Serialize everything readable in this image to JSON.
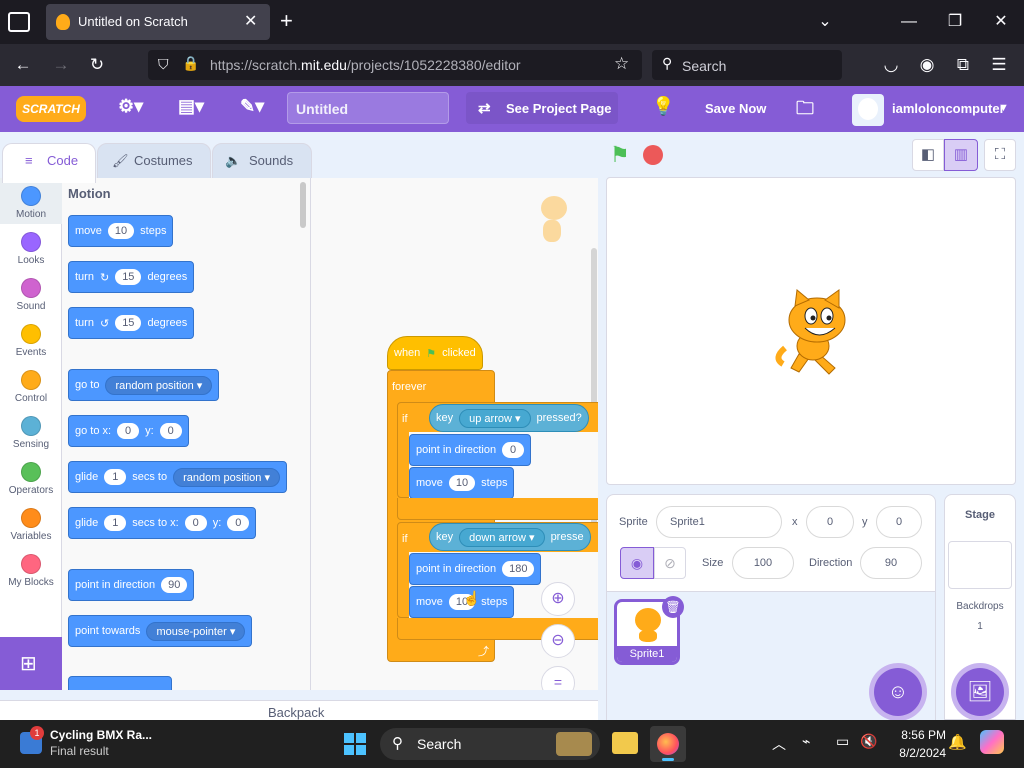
{
  "browser": {
    "tab_title": "Untitled on Scratch",
    "url_prefix": "https://scratch.",
    "url_domain": "mit.edu",
    "url_path": "/projects/1052228380/editor",
    "search_placeholder": "Search"
  },
  "menubar": {
    "logo": "SCRATCH",
    "project_title": "Untitled",
    "see_project_page": "See Project Page",
    "save_now": "Save Now",
    "username": "iamloloncomputer"
  },
  "editor_tabs": {
    "code": "Code",
    "costumes": "Costumes",
    "sounds": "Sounds"
  },
  "categories": [
    {
      "label": "Motion",
      "color": "#4c97ff"
    },
    {
      "label": "Looks",
      "color": "#9966ff"
    },
    {
      "label": "Sound",
      "color": "#cf63cf"
    },
    {
      "label": "Events",
      "color": "#ffbf00"
    },
    {
      "label": "Control",
      "color": "#ffab19"
    },
    {
      "label": "Sensing",
      "color": "#5cb1d6"
    },
    {
      "label": "Operators",
      "color": "#59c059"
    },
    {
      "label": "Variables",
      "color": "#ff8c1a"
    },
    {
      "label": "My Blocks",
      "color": "#ff6680"
    }
  ],
  "palette": {
    "heading": "Motion",
    "move": {
      "a": "move",
      "v": "10",
      "b": "steps"
    },
    "turn_right": {
      "a": "turn",
      "v": "15",
      "b": "degrees"
    },
    "turn_left": {
      "a": "turn",
      "v": "15",
      "b": "degrees"
    },
    "goto": {
      "a": "go to",
      "v": "random position"
    },
    "goto_xy": {
      "a": "go to x:",
      "x": "0",
      "b": "y:",
      "y": "0"
    },
    "glide_to": {
      "a": "glide",
      "v": "1",
      "b": "secs to",
      "c": "random position"
    },
    "glide_xy": {
      "a": "glide",
      "v": "1",
      "b": "secs to x:",
      "x": "0",
      "c": "y:",
      "y": "0"
    },
    "point_dir": {
      "a": "point in direction",
      "v": "90"
    },
    "point_towards": {
      "a": "point towards",
      "v": "mouse-pointer"
    }
  },
  "script": {
    "hat": {
      "a": "when",
      "b": "clicked"
    },
    "forever": "forever",
    "if1": {
      "if": "if",
      "key": "key",
      "keyname": "up arrow",
      "pressed": "pressed?"
    },
    "point1": {
      "a": "point in direction",
      "v": "0"
    },
    "move1": {
      "a": "move",
      "v": "10",
      "b": "steps"
    },
    "if2": {
      "if": "if",
      "key": "key",
      "keyname": "down arrow",
      "pressed": "presse"
    },
    "point2": {
      "a": "point in direction",
      "v": "180"
    },
    "move2": {
      "a": "move",
      "v": "10",
      "b": "steps"
    }
  },
  "backpack": "Backpack",
  "sprite_info": {
    "sprite_label": "Sprite",
    "sprite_name": "Sprite1",
    "x_label": "x",
    "x": "0",
    "y_label": "y",
    "y": "0",
    "size_label": "Size",
    "size": "100",
    "direction_label": "Direction",
    "direction": "90"
  },
  "sprite_thumb": "Sprite1",
  "stage_panel": {
    "title": "Stage",
    "backdrops_label": "Backdrops",
    "backdrops_count": "1"
  },
  "taskbar": {
    "notif_badge": "1",
    "notif_title": "Cycling BMX Ra...",
    "notif_sub": "Final result",
    "search": "Search",
    "time": "8:56 PM",
    "date": "8/2/2024"
  },
  "colors": {
    "scratch_purple": "#855cd6",
    "motion": "#4c97ff",
    "control": "#ffab19",
    "sensing": "#5cb1d6"
  }
}
